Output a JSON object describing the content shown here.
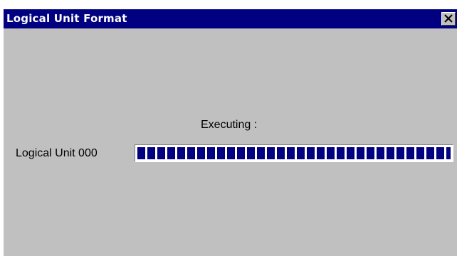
{
  "window": {
    "title": "Logical Unit Format",
    "close_icon": "close-icon"
  },
  "content": {
    "status_label": "Executing :",
    "unit_label": "Logical Unit 000"
  },
  "progress": {
    "fraction": 1.0
  },
  "colors": {
    "titlebar": "#000080",
    "window_bg": "#c0c0c0",
    "progress_block": "#000080"
  }
}
